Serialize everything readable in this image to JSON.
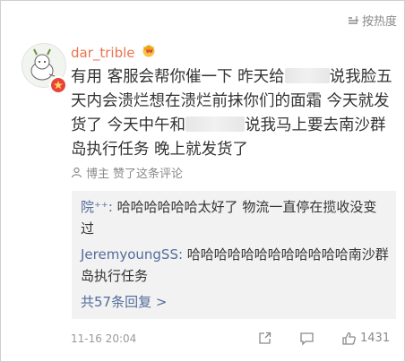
{
  "sort": {
    "label": "按热度"
  },
  "comment": {
    "username": "dar_trible",
    "text_parts": [
      "有用 客服会帮你催一下 昨天给",
      "说我脸五天内会溃烂想在溃烂前抹你们的面霜 今天就发货了 今天中午和",
      "说我马上要去南沙群岛执行任务 晚上就发货了"
    ],
    "author_label": "博主",
    "author_liked": "赞了这条评论",
    "timestamp": "11-16 20:04",
    "like_count": "1431"
  },
  "replies": [
    {
      "name": "院⁺⁺:",
      "text": " 哈哈哈哈哈哈太好了 物流一直停在揽收没变过"
    },
    {
      "name": "JeremyoungSS:",
      "text": " 哈哈哈哈哈哈哈哈哈哈哈哈南沙群岛执行任务"
    }
  ],
  "more_replies": "共57条回复 >",
  "colors": {
    "username": "#eb7350",
    "link": "#526d9b",
    "badge": "#e8423c"
  },
  "icons": [
    "sort-icon",
    "avatar-image",
    "verified-badge-icon",
    "crown-icon",
    "author-icon",
    "share-icon",
    "comment-icon",
    "like-icon"
  ]
}
